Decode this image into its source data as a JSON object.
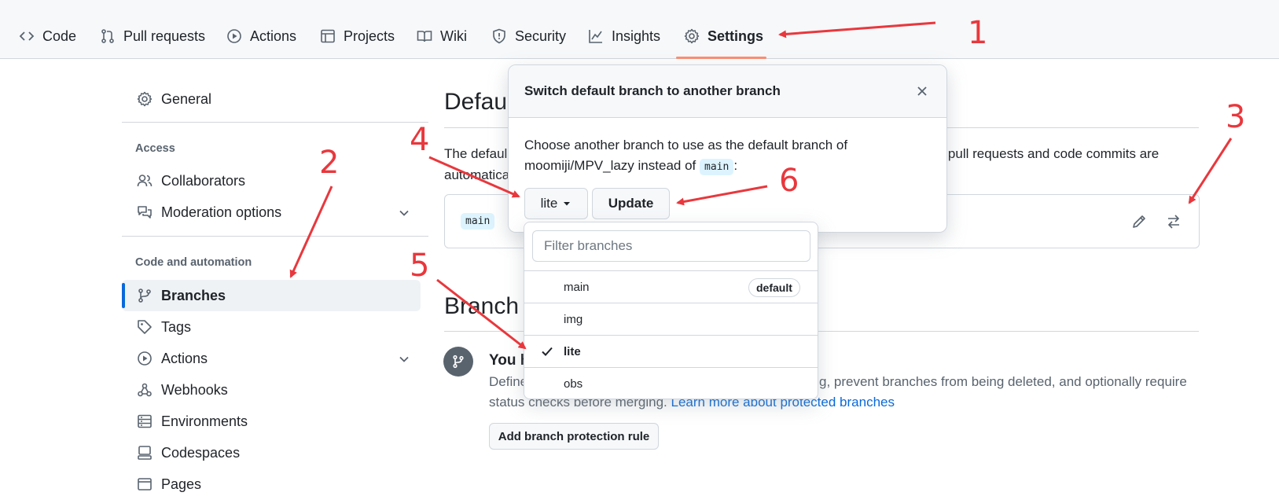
{
  "nav": {
    "code": "Code",
    "pull_requests": "Pull requests",
    "actions": "Actions",
    "projects": "Projects",
    "wiki": "Wiki",
    "security": "Security",
    "insights": "Insights",
    "settings": "Settings"
  },
  "sidebar": {
    "general": "General",
    "access_heading": "Access",
    "collaborators": "Collaborators",
    "moderation": "Moderation options",
    "code_heading": "Code and automation",
    "branches": "Branches",
    "tags": "Tags",
    "actions": "Actions",
    "webhooks": "Webhooks",
    "environments": "Environments",
    "codespaces": "Codespaces",
    "pages": "Pages"
  },
  "main": {
    "default_heading": "Defau",
    "default_desc_line1_left": "The defaul",
    "default_desc_line1_right": "n all pull requests and code commits are",
    "default_desc_line2": "automatica",
    "current_default": "main",
    "protection_heading": "Branch",
    "protection_title": "You h",
    "protection_desc_line1_left": "Define",
    "protection_desc_line1_right": "g, prevent branches from being deleted, and optionally require",
    "protection_desc_line2": "status checks before merging.",
    "protection_link": "Learn more about protected branches",
    "add_rule_button": "Add branch protection rule"
  },
  "modal": {
    "title": "Switch default branch to another branch",
    "text_line1": "Choose another branch to use as the default branch of",
    "text_line2": "moomiji/MPV_lazy instead of",
    "current_branch": "main",
    "colon": ":",
    "branch_button": "lite",
    "update_button": "Update"
  },
  "dropdown": {
    "filter_placeholder": "Filter branches",
    "branches": [
      {
        "name": "main",
        "badge": "default",
        "selected": false
      },
      {
        "name": "img",
        "badge": "",
        "selected": false
      },
      {
        "name": "lite",
        "badge": "",
        "selected": true
      },
      {
        "name": "obs",
        "badge": "",
        "selected": false
      }
    ]
  },
  "annotations": {
    "n1": "1",
    "n2": "2",
    "n3": "3",
    "n4": "4",
    "n5": "5",
    "n6": "6",
    "color": "#e8383d"
  },
  "colors": {
    "accent": "#0969da",
    "tab_underline": "#fd8c73",
    "code_chip_bg": "#ddf4ff"
  }
}
